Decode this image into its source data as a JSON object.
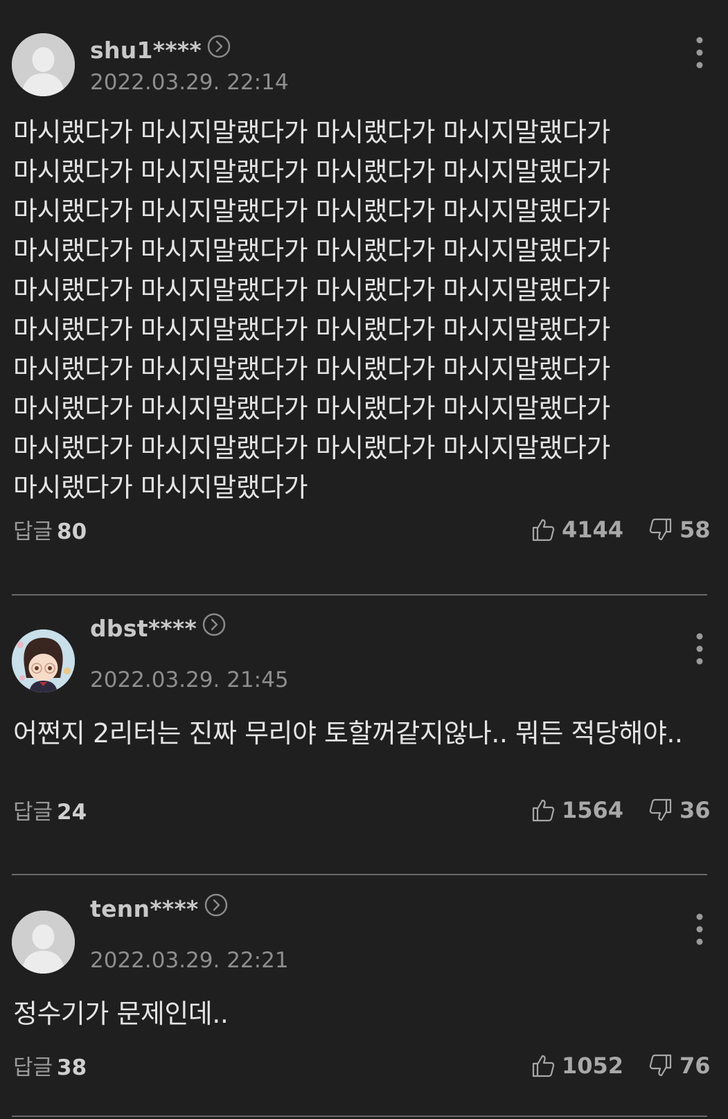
{
  "colors": {
    "background": "#1f1f1f",
    "nickname": "#c8c8c8",
    "date": "#8e8e8e",
    "body": "#e4e4e4",
    "divider": "#6a6a6a"
  },
  "comments": [
    {
      "avatar_icon": "default-avatar-icon",
      "nickname": "shu1****",
      "date": "2022.03.29. 22:14",
      "text": "마시랬다가 마시지말랬다가 마시랬다가 마시지말랬다가 마시랬다가 마시지말랬다가 마시랬다가 마시지말랬다가 마시랬다가 마시지말랬다가 마시랬다가 마시지말랬다가 마시랬다가 마시지말랬다가 마시랬다가 마시지말랬다가 마시랬다가 마시지말랬다가 마시랬다가 마시지말랬다가 마시랬다가 마시지말랬다가 마시랬다가 마시지말랬다가 마시랬다가 마시지말랬다가 마시랬다가 마시지말랬다가 마시랬다가 마시지말랬다가 마시랬다가 마시지말랬다가 마시랬다가 마시지말랬다가 마시랬다가 마시지말랬다가 마시랬다가 마시지말랬다가",
      "reply_label": "답글",
      "reply_count": "80",
      "likes": "4144",
      "dislikes": "58"
    },
    {
      "avatar_icon": "character-avatar-icon",
      "nickname": "dbst****",
      "date": "2022.03.29. 21:45",
      "text": "어쩐지 2리터는 진짜 무리야 토할꺼같지않나.. 뭐든 적당해야..",
      "reply_label": "답글",
      "reply_count": "24",
      "likes": "1564",
      "dislikes": "36"
    },
    {
      "avatar_icon": "default-avatar-icon",
      "nickname": "tenn****",
      "date": "2022.03.29. 22:21",
      "text": "정수기가 문제인데..",
      "reply_label": "답글",
      "reply_count": "38",
      "likes": "1052",
      "dislikes": "76"
    }
  ]
}
